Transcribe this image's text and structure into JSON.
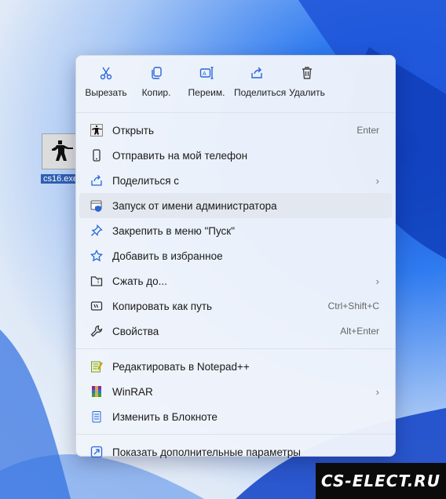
{
  "desktop": {
    "icon_label": "cs16.exe"
  },
  "toolbar": [
    {
      "label": "Вырезать",
      "icon": "scissors-icon"
    },
    {
      "label": "Копир.",
      "icon": "copy-icon"
    },
    {
      "label": "Переим.",
      "icon": "rename-icon"
    },
    {
      "label": "Поделиться",
      "icon": "share-icon"
    },
    {
      "label": "Удалить",
      "icon": "trash-icon"
    }
  ],
  "menu": {
    "open": {
      "label": "Открыть",
      "shortcut": "Enter"
    },
    "send_phone": {
      "label": "Отправить на мой телефон"
    },
    "share_with": {
      "label": "Поделиться с",
      "arrow": "›"
    },
    "run_admin": {
      "label": "Запуск от имени администратора"
    },
    "pin_start": {
      "label": "Закрепить в меню \"Пуск\""
    },
    "favorites": {
      "label": "Добавить в избранное"
    },
    "compress": {
      "label": "Сжать до...",
      "arrow": "›"
    },
    "copy_path": {
      "label": "Копировать как путь",
      "shortcut": "Ctrl+Shift+C"
    },
    "properties": {
      "label": "Свойства",
      "shortcut": "Alt+Enter"
    },
    "notepadpp": {
      "label": "Редактировать в Notepad++"
    },
    "winrar": {
      "label": "WinRAR",
      "arrow": "›"
    },
    "notepad": {
      "label": "Изменить в Блокноте"
    },
    "more": {
      "label": "Показать дополнительные параметры"
    }
  },
  "watermark": {
    "text": "CS-ELECT.RU"
  }
}
